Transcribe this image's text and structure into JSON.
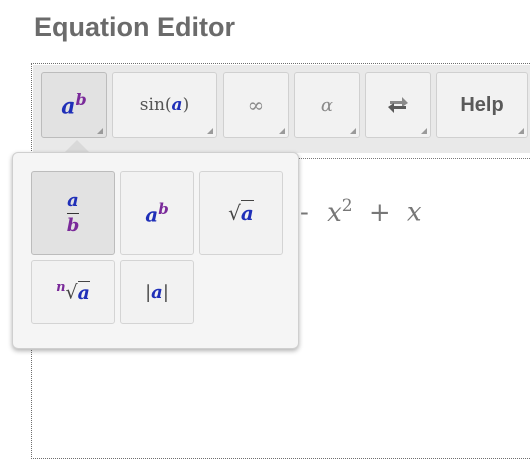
{
  "title": "Equation Editor",
  "toolbar": {
    "power": {
      "base": "a",
      "exp": "b"
    },
    "func": {
      "name": "sin",
      "arg": "a"
    },
    "infinity": "∞",
    "alpha": "α",
    "help": "Help"
  },
  "popup": {
    "fraction": {
      "num": "a",
      "den": "b"
    },
    "power": {
      "base": "a",
      "exp": "b"
    },
    "sqrt": {
      "sign": "√",
      "arg": "a"
    },
    "nthroot": {
      "index": "n",
      "sign": "√",
      "arg": "a"
    },
    "abs": {
      "bar": "|",
      "arg": "a"
    }
  },
  "expression": {
    "dash": "-",
    "var1": "x",
    "exp": "2",
    "plus": "+",
    "var2": "x"
  },
  "colors": {
    "base": "#1f2fb8",
    "exponent": "#7a2a9a"
  }
}
